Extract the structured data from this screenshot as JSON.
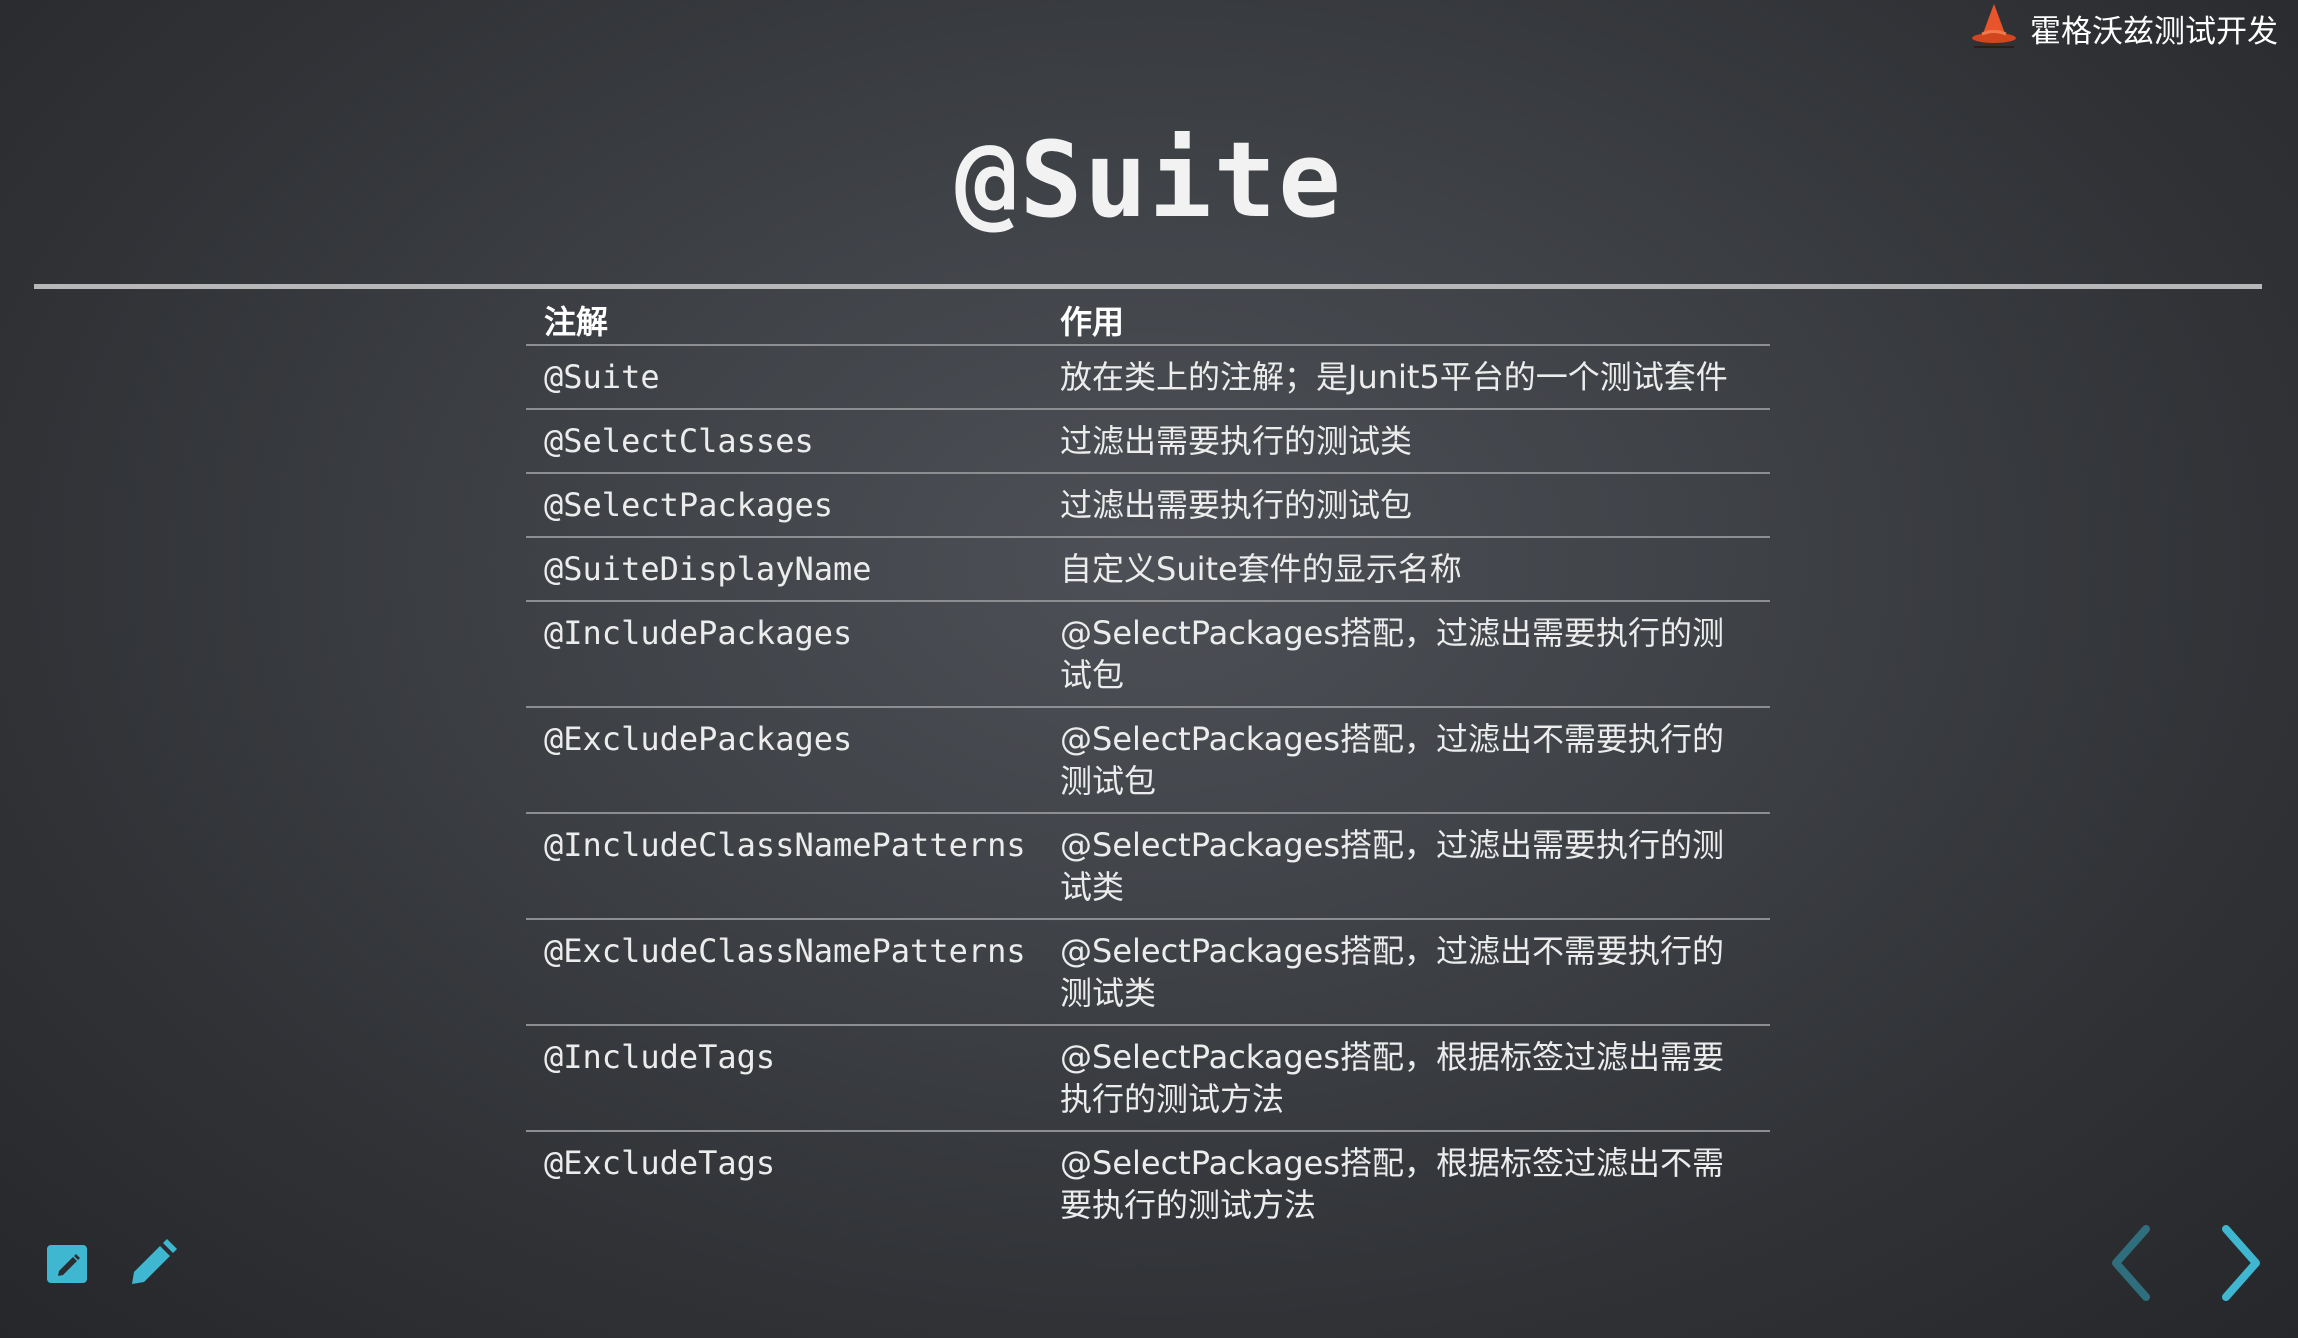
{
  "brand": {
    "name": "霍格沃兹测试开发",
    "logo_icon": "wizard-hat-icon"
  },
  "slide": {
    "title": "@Suite"
  },
  "table": {
    "headers": [
      "注解",
      "作用"
    ],
    "rows": [
      {
        "annotation": "@Suite",
        "description": "放在类上的注解；是Junit5平台的一个测试套件"
      },
      {
        "annotation": "@SelectClasses",
        "description": "过滤出需要执行的测试类"
      },
      {
        "annotation": "@SelectPackages",
        "description": "过滤出需要执行的测试包"
      },
      {
        "annotation": "@SuiteDisplayName",
        "description": "自定义Suite套件的显示名称"
      },
      {
        "annotation": "@IncludePackages",
        "description": "@SelectPackages搭配，过滤出需要执行的测试包"
      },
      {
        "annotation": "@ExcludePackages",
        "description": "@SelectPackages搭配，过滤出不需要执行的测试包"
      },
      {
        "annotation": "@IncludeClassNamePatterns",
        "description": "@SelectPackages搭配，过滤出需要执行的测试类"
      },
      {
        "annotation": "@ExcludeClassNamePatterns",
        "description": "@SelectPackages搭配，过滤出不需要执行的测试类"
      },
      {
        "annotation": "@IncludeTags",
        "description": "@SelectPackages搭配，根据标签过滤出需要执行的测试方法"
      },
      {
        "annotation": "@ExcludeTags",
        "description": "@SelectPackages搭配，根据标签过滤出不需要执行的测试方法"
      }
    ]
  },
  "controls": {
    "edit_icon": "edit-note-icon",
    "pencil_icon": "pencil-icon",
    "prev_icon": "chevron-left-icon",
    "next_icon": "chevron-right-icon"
  },
  "colors": {
    "accent": "#3fb7d0",
    "accent_dim": "#2f6f7d",
    "brand_orange": "#e8542b"
  }
}
